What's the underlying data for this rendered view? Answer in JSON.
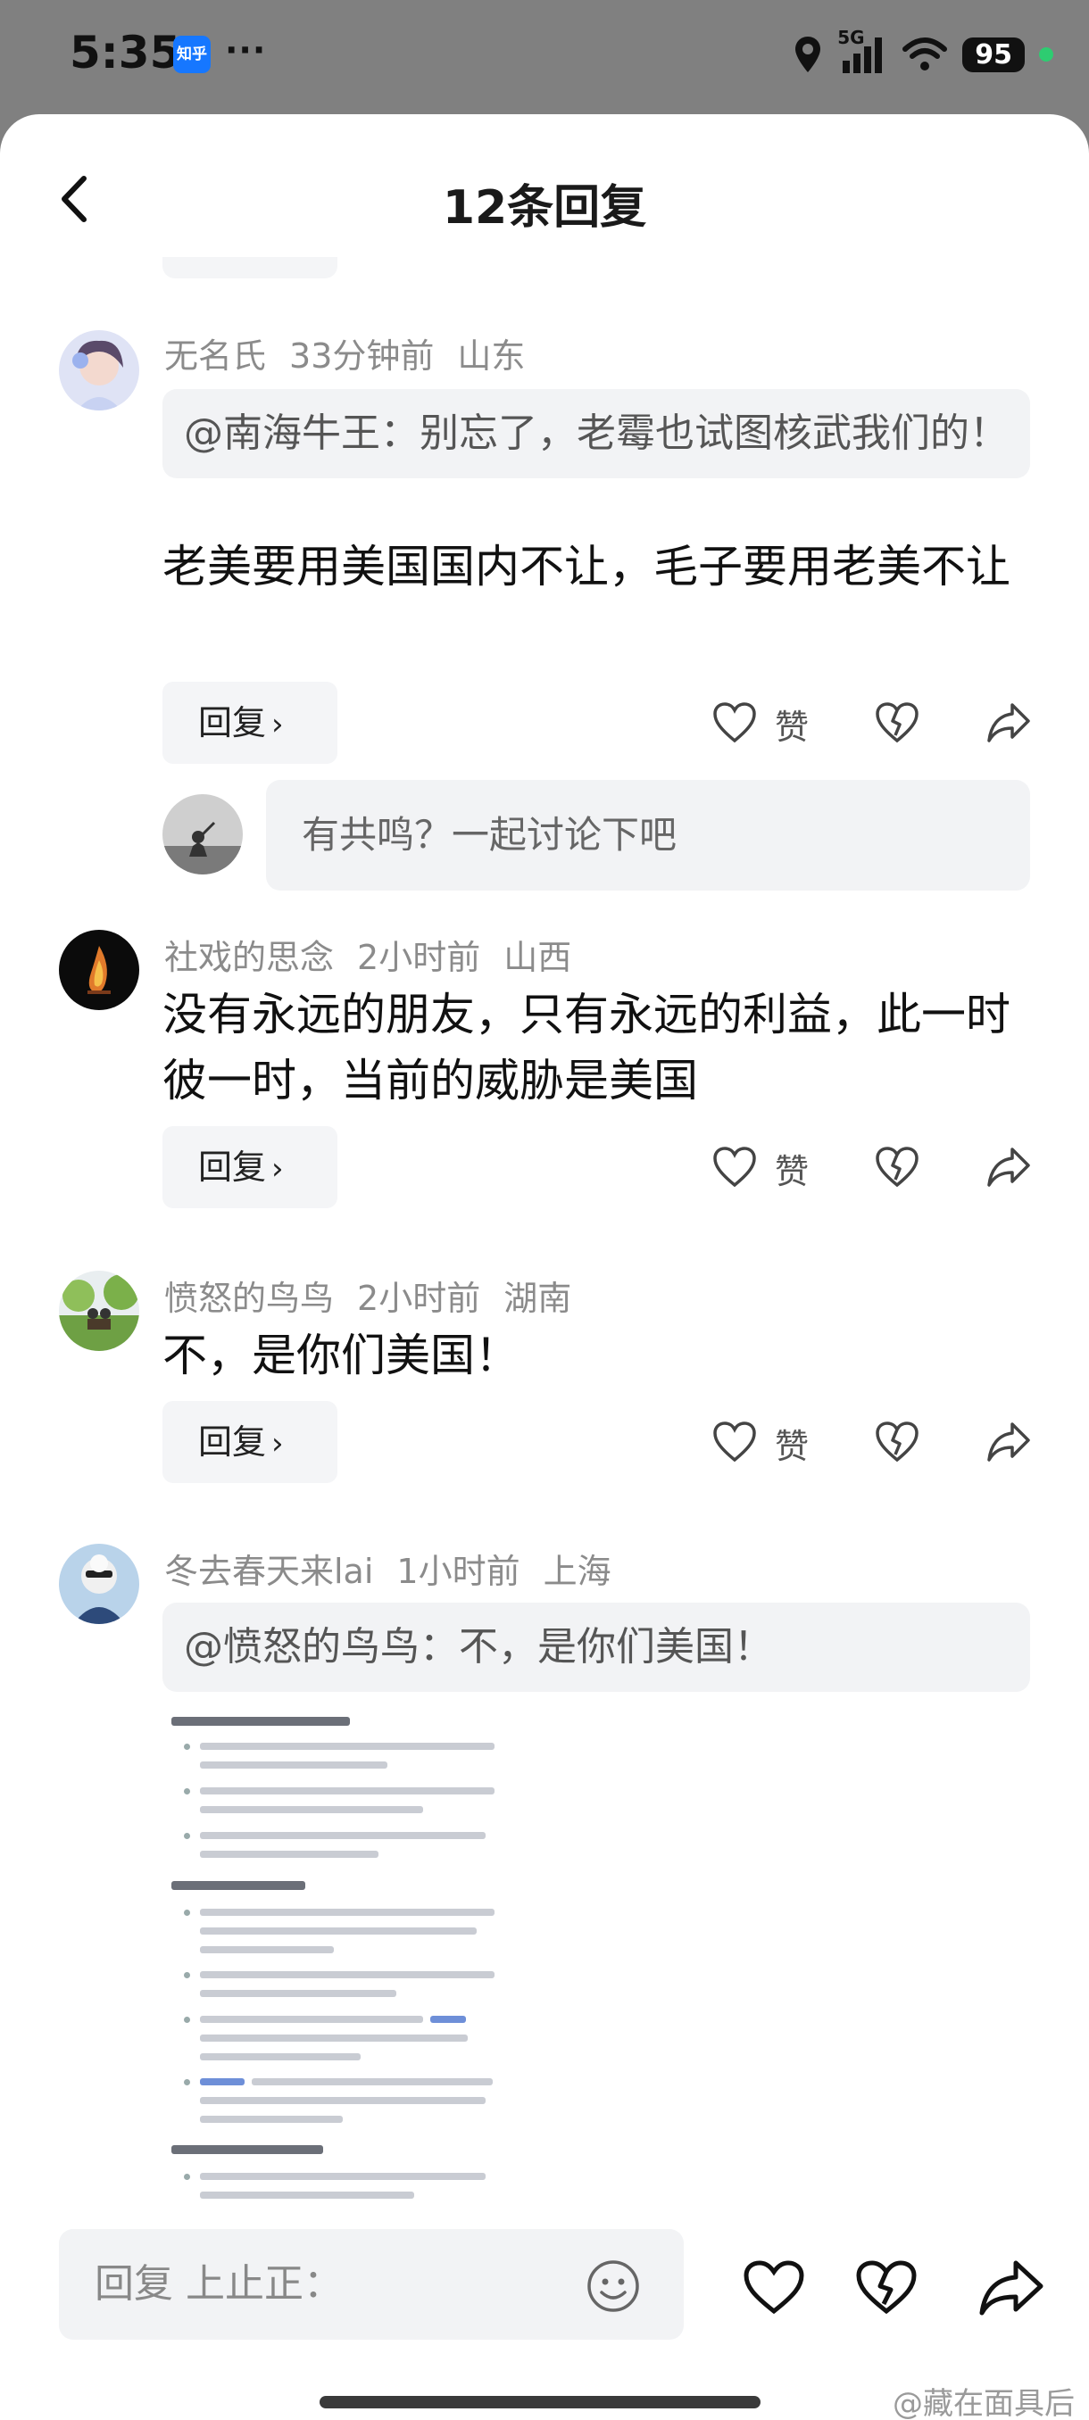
{
  "status": {
    "time": "5:35",
    "app_badge": "知乎",
    "more": "···",
    "network": "5G",
    "battery": "95"
  },
  "header": {
    "title": "12条回复"
  },
  "comments": [
    {
      "user": "无名氏",
      "time": "33分钟前",
      "location": "山东",
      "quote": "@南海牛王：别忘了，老霉也试图核武我们的！",
      "text": "老美要用美国国内不让，毛子要用老美不让"
    },
    {
      "user": "社戏的思念",
      "time": "2小时前",
      "location": "山西",
      "text": "没有永远的朋友，只有永远的利益，此一时彼一时，当前的威胁是美国"
    },
    {
      "user": "愤怒的鸟鸟",
      "time": "2小时前",
      "location": "湖南",
      "text": "不，是你们美国！"
    },
    {
      "user": "冬去春天来lai",
      "time": "1小时前",
      "location": "上海",
      "quote": "@愤怒的鸟鸟：不，是你们美国！"
    }
  ],
  "actions": {
    "reply_label": "回复",
    "like_label": "赞",
    "chevron": "›"
  },
  "reply_input": {
    "placeholder": "有共鸣？一起讨论下吧"
  },
  "bottom": {
    "placeholder": "回复 上止正："
  },
  "watermark": "@藏在面具后",
  "colors": {
    "accent": "#1677ff",
    "meta": "#8b8b8b",
    "quote_bg": "#f2f3f5"
  },
  "icons": [
    "chevron-left-icon",
    "heart-icon",
    "broken-heart-icon",
    "share-arrow-icon",
    "emoji-icon",
    "location-icon",
    "signal-icon",
    "wifi-icon"
  ]
}
